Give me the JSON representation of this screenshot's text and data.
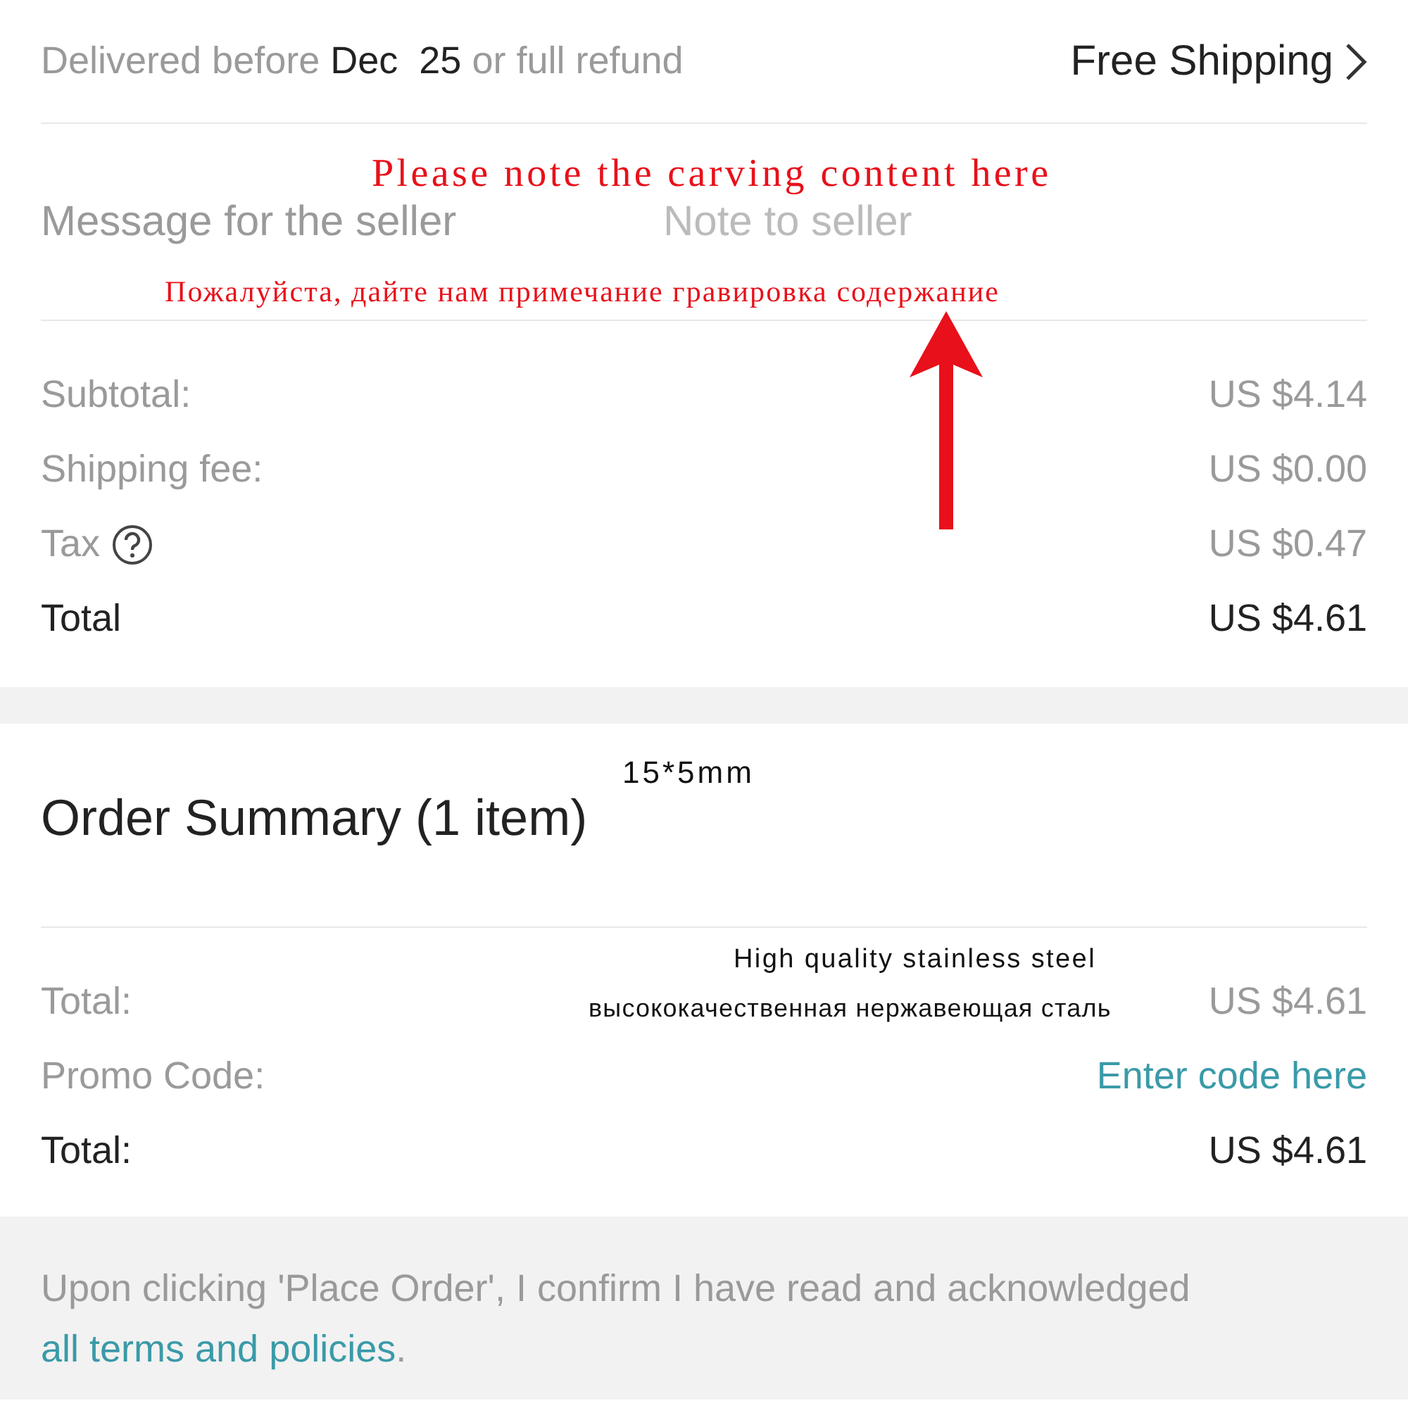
{
  "delivery": {
    "text": "Delivered before **Dec  25** or full refund",
    "shipping": "Free Shipping"
  },
  "message": {
    "label": "Message for the seller",
    "placeholder": "Note to seller"
  },
  "costs": [
    {
      "label": "Subtotal:",
      "value": "US $4.14",
      "kind": "plain"
    },
    {
      "label": "Shipping fee:",
      "value": "US $0.00",
      "kind": "plain"
    },
    {
      "label": "Tax",
      "value": "US $0.47",
      "kind": "info"
    },
    {
      "label": "Total",
      "value": "US $4.61",
      "kind": "total"
    }
  ],
  "order_summary": {
    "title": "Order Summary (1 item)",
    "rows": [
      {
        "label": "Total:",
        "value": "US $4.61",
        "kind": "plain"
      },
      {
        "label": "Promo Code:",
        "value": "Enter code here",
        "kind": "link"
      },
      {
        "label": "Total:",
        "value": "US $4.61",
        "kind": "total"
      }
    ]
  },
  "terms": {
    "text": "Upon clicking 'Place Order', I confirm I have read and acknowledged",
    "link": "all terms and policies",
    "after": "."
  },
  "annotations": {
    "note_en": "Please note the carving content here",
    "note_ru": "Пожалуйста, дайте нам примечание гравировка содержание",
    "size": "15*5mm",
    "material_en": "High quality stainless steel",
    "material_ru": "высококачественная нержавеющая сталь"
  }
}
